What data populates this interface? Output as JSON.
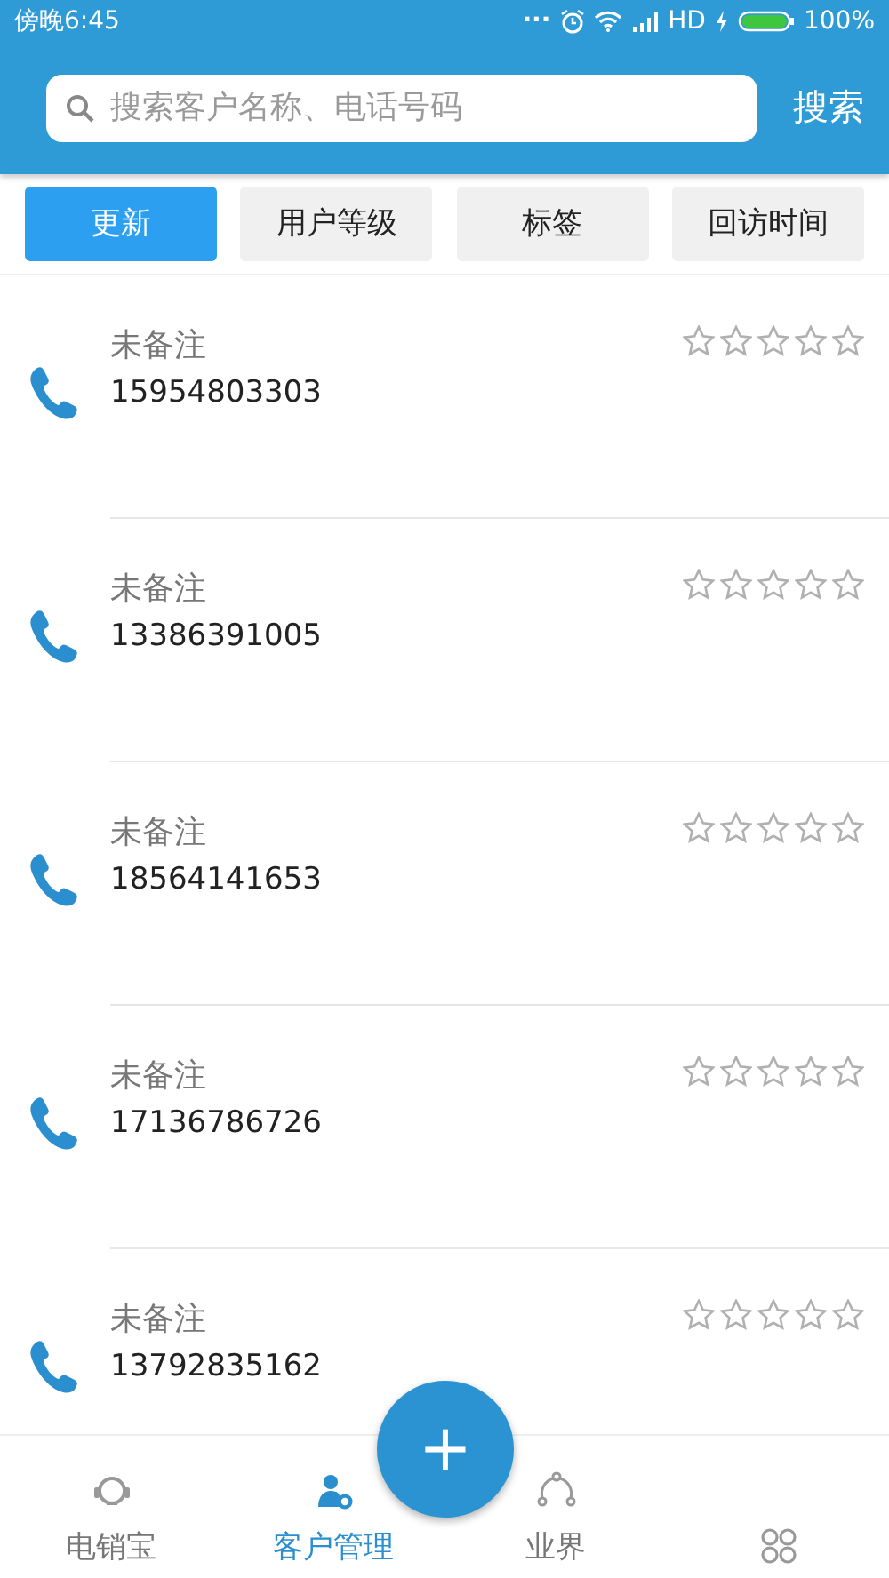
{
  "status_bar": {
    "time": "傍晚6:45",
    "dots": "...",
    "network": "HD",
    "battery": "100%"
  },
  "search": {
    "placeholder": "搜索客户名称、电话号码",
    "button": "搜索"
  },
  "filters": [
    {
      "label": "更新",
      "selected": true
    },
    {
      "label": "用户等级",
      "selected": false
    },
    {
      "label": "标签",
      "selected": false
    },
    {
      "label": "回访时间",
      "selected": false
    }
  ],
  "contacts": [
    {
      "note": "未备注",
      "phone": "15954803303",
      "stars": 0
    },
    {
      "note": "未备注",
      "phone": "13386391005",
      "stars": 0
    },
    {
      "note": "未备注",
      "phone": "18564141653",
      "stars": 0
    },
    {
      "note": "未备注",
      "phone": "17136786726",
      "stars": 0
    },
    {
      "note": "未备注",
      "phone": "13792835162",
      "stars": 0
    }
  ],
  "fab": {
    "label": "+"
  },
  "nav": [
    {
      "kind": "headset",
      "label": "电销宝",
      "selected": false
    },
    {
      "kind": "user-gear",
      "label": "客户管理",
      "selected": true
    },
    {
      "kind": "nodes",
      "label": "业界",
      "selected": false
    },
    {
      "kind": "clover",
      "selected": false
    }
  ]
}
